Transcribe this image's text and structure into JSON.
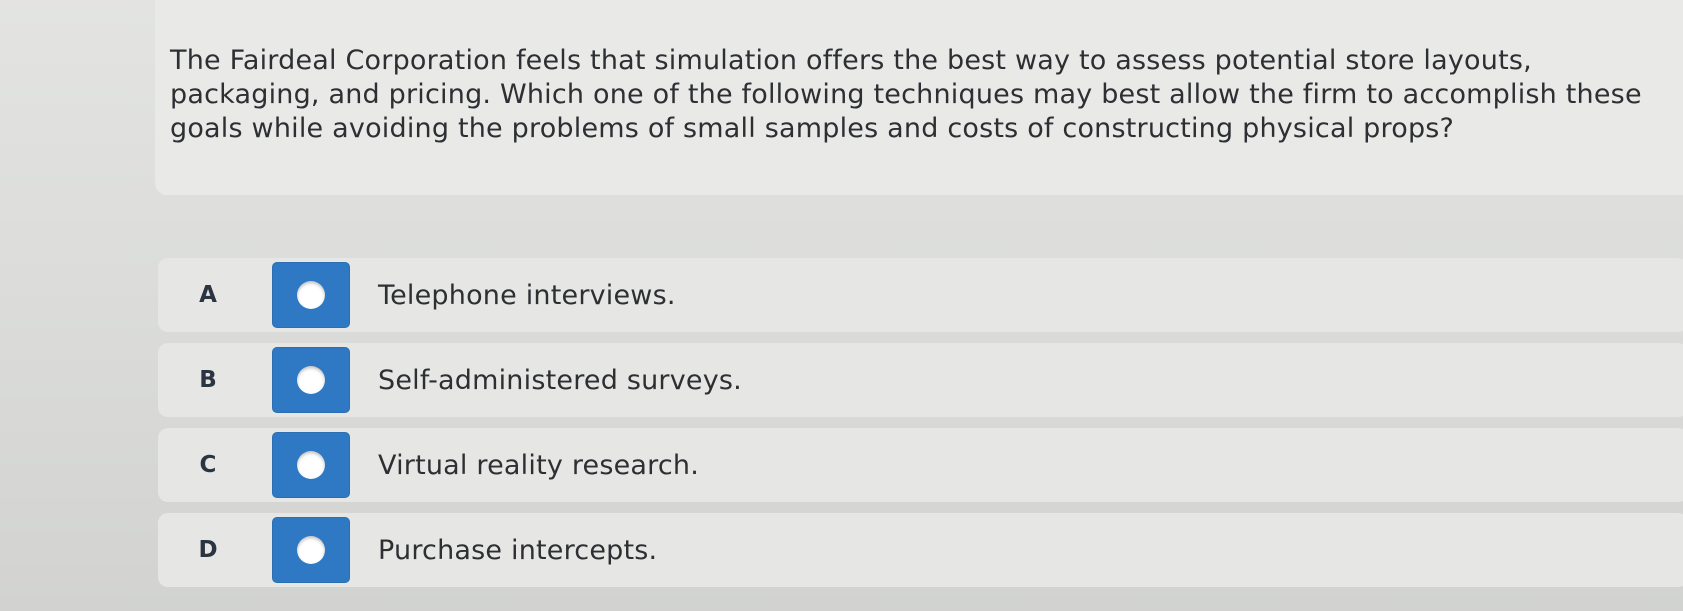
{
  "question": {
    "text": "The Fairdeal Corporation feels that simulation offers the best way to assess potential store layouts, packaging, and pricing. Which one of the following techniques may best allow the firm to accomplish these goals while avoiding the problems of small samples and costs of constructing physical props?"
  },
  "options": [
    {
      "letter": "A",
      "label": "Telephone interviews.",
      "selected": false
    },
    {
      "letter": "B",
      "label": "Self-administered surveys.",
      "selected": false
    },
    {
      "letter": "C",
      "label": "Virtual reality research.",
      "selected": false
    },
    {
      "letter": "D",
      "label": "Purchase intercepts.",
      "selected": false
    }
  ],
  "colors": {
    "radio_box": "#2e78c4",
    "text": "#2d2f33"
  },
  "icons": {
    "radio": "radio-unselected-icon"
  }
}
